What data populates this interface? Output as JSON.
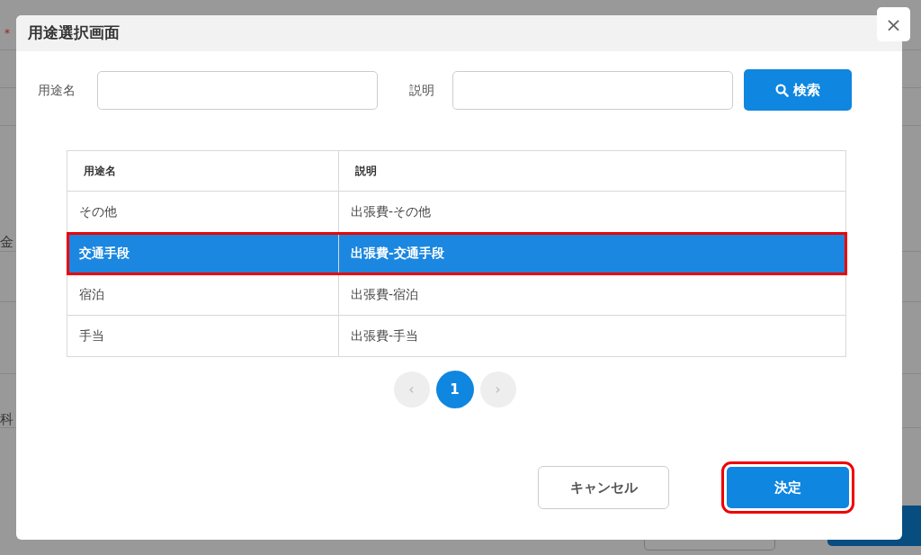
{
  "background": {
    "required_mark": "*",
    "labels": [
      "金",
      "科"
    ]
  },
  "dialog": {
    "title": "用途選択画面",
    "close": "×"
  },
  "search": {
    "fields": [
      {
        "label": "用途名"
      },
      {
        "label": "説明"
      }
    ],
    "button": "検索"
  },
  "table": {
    "columns": [
      "用途名",
      "説明"
    ],
    "rows": [
      {
        "cells": [
          "その他",
          "出張費-その他"
        ],
        "selected": false,
        "annotated": false
      },
      {
        "cells": [
          "交通手段",
          "出張費-交通手段"
        ],
        "selected": true,
        "annotated": true
      },
      {
        "cells": [
          "宿泊",
          "出張費-宿泊"
        ],
        "selected": false,
        "annotated": false
      },
      {
        "cells": [
          "手当",
          "出張費-手当"
        ],
        "selected": false,
        "annotated": false
      }
    ]
  },
  "pagination": {
    "prev": "‹",
    "pages": [
      {
        "label": "1",
        "selected": true
      }
    ],
    "next": "›"
  },
  "buttons": [
    {
      "kind": "secondary",
      "label": "キャンセル",
      "annotated": false
    },
    {
      "kind": "primary",
      "label": "決定",
      "annotated": true
    }
  ]
}
